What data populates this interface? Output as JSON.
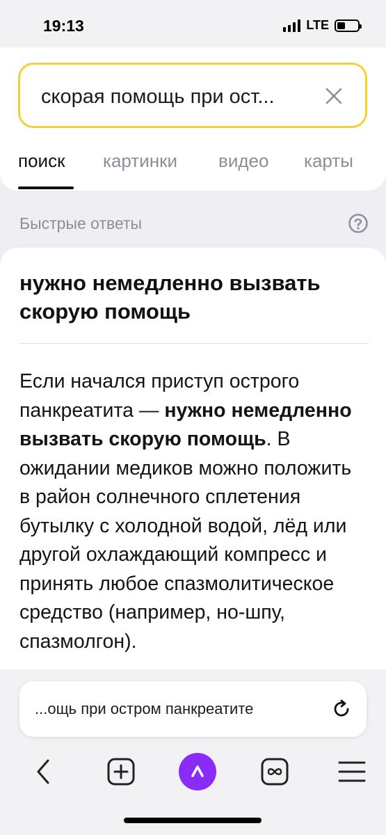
{
  "status_bar": {
    "time": "19:13",
    "network": "LTE"
  },
  "search": {
    "query": "скорая помощь при ост..."
  },
  "tabs": [
    {
      "label": "поиск",
      "active": true
    },
    {
      "label": "картинки",
      "active": false
    },
    {
      "label": "видео",
      "active": false
    },
    {
      "label": "карты",
      "active": false
    }
  ],
  "quick_answers": {
    "label": "Быстрые ответы",
    "title": "нужно немедленно вызвать скорую помощь",
    "body": {
      "p1": "Если начался приступ острого панкреатита — ",
      "bold": "нужно немедленно вызвать скорую помощь",
      "p2": ". В ожидании медиков можно положить в район солнечного сплетения бутылку с холодной водой, лёд или другой охлаждающий компресс и принять любое спазмолитическое средство (например, но-шпу, спазмолгон)."
    }
  },
  "browser": {
    "url": "...ощь при остром панкреатите"
  },
  "colors": {
    "search_border": "#f6cf3a",
    "alice": "#8a2cf7",
    "muted_text": "#8b8e9a"
  }
}
